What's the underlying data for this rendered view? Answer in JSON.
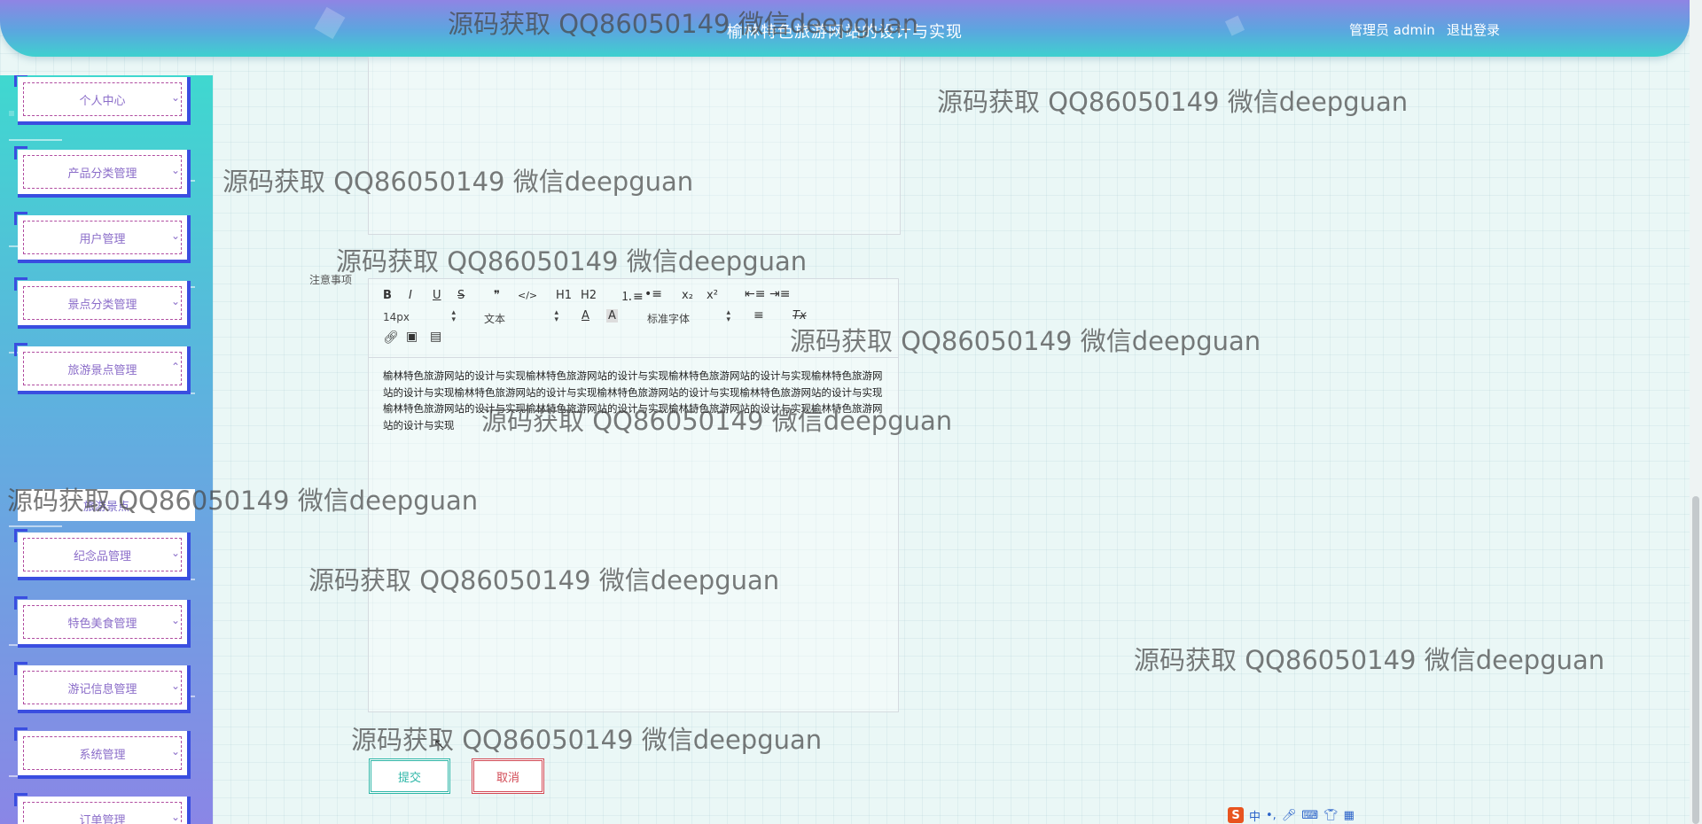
{
  "header": {
    "title": "榆林特色旅游网站的设计与实现",
    "user": "管理员 admin",
    "logout": "退出登录"
  },
  "sidebar": {
    "items": [
      {
        "label": "个人中心",
        "chevron": "chevron-down"
      },
      {
        "label": "产品分类管理",
        "chevron": "chevron-down"
      },
      {
        "label": "用户管理",
        "chevron": "chevron-down"
      },
      {
        "label": "景点分类管理",
        "chevron": "chevron-down"
      },
      {
        "label": "旅游景点管理",
        "chevron": "chevron-up"
      },
      {
        "label": "纪念品管理",
        "chevron": "chevron-down"
      },
      {
        "label": "特色美食管理",
        "chevron": "chevron-down"
      },
      {
        "label": "游记信息管理",
        "chevron": "chevron-down"
      },
      {
        "label": "系统管理",
        "chevron": "chevron-down"
      },
      {
        "label": "订单管理",
        "chevron": "chevron-down"
      }
    ],
    "sub_item": "旅游景点"
  },
  "form": {
    "notes_label": "注意事项",
    "toolbar": {
      "bold": "B",
      "italic": "I",
      "underline": "U",
      "strike": "S",
      "quote": "❞",
      "code": "</>",
      "h1": "H1",
      "h2": "H2",
      "sub": "x₂",
      "sup": "x²",
      "size": "14px",
      "para": "文本",
      "font": "标准字体",
      "color_icon": "font-color-icon",
      "bg_icon": "background-color-icon",
      "clear": "Tx"
    },
    "content": "榆林特色旅游网站的设计与实现榆林特色旅游网站的设计与实现榆林特色旅游网站的设计与实现榆林特色旅游网站的设计与实现榆林特色旅游网站的设计与实现榆林特色旅游网站的设计与实现榆林特色旅游网站的设计与实现榆林特色旅游网站的设计与实现榆林特色旅游网站的设计与实现榆林特色旅游网站的设计与实现榆林特色旅游网站的设计与实现",
    "submit": "提交",
    "cancel": "取消"
  },
  "watermark": "源码获取 QQ86050149 微信deepguan",
  "ime": {
    "logo": "S",
    "lang": "中"
  }
}
